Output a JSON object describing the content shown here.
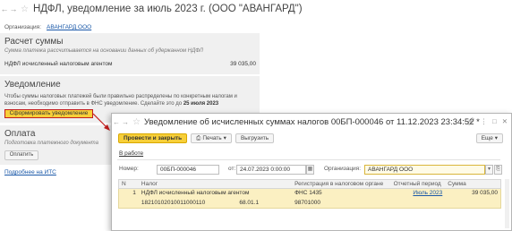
{
  "background": {
    "title": "НДФЛ, уведомление за июль 2023 г. (ООО \"АВАНГАРД\")",
    "org_label": "Организация:",
    "org_value": "АВАНГАРД ООО",
    "calc": {
      "heading": "Расчет суммы",
      "hint": "Сумма платежа рассчитывается на основании данных об удержанном НДФЛ",
      "row_label": "НДФЛ исчисленный налоговым агентом",
      "row_value": "39 035,00"
    },
    "notice": {
      "heading": "Уведомление",
      "text_1": "Чтобы суммы налоговых платежей были правильно распределены по конкретным налогам и",
      "text_2": "взносам, необходимо отправить в ФНС уведомление. Сделайте это до",
      "deadline": "25 июля 2023",
      "button": "Сформировать уведомление"
    },
    "payment": {
      "heading": "Оплата",
      "hint": "Подготовка платежного документа",
      "button": "Оплатить"
    },
    "its_link": "Подробнее на ИТС"
  },
  "window": {
    "title": "Уведомление об исчисленных суммах налогов 00БП-000046 от 11.12.2023 23:34:52 *",
    "toolbar": {
      "post_close": "Провести и закрыть",
      "print": "Печать",
      "upload": "Выгрузить",
      "more": "Еще"
    },
    "status_link": "В работе",
    "number_label": "Номер:",
    "number_value": "00БП-000046",
    "date_label": "от:",
    "date_value": "24.07.2023  0:00:00",
    "org_label": "Организация:",
    "org_value": "АВАНГАРД ООО",
    "table": {
      "headers": [
        "N",
        "Налог",
        "Регистрация в налоговом органе",
        "Отчетный период",
        "Сумма"
      ],
      "row": {
        "n": "1",
        "tax": "НДФЛ исчисленный налоговым агентом",
        "kbk": "18210102010011000110",
        "code": "68.01.1",
        "reg": "ФНС 1435",
        "oktmo": "98701000",
        "period": "Июль 2023",
        "sum": "39 035,00"
      }
    }
  },
  "colors": {
    "accent_yellow": "#f7cf39",
    "link_blue": "#1a58a8",
    "highlight_red": "#c21d1d",
    "row_selected": "#fbf0c2"
  }
}
